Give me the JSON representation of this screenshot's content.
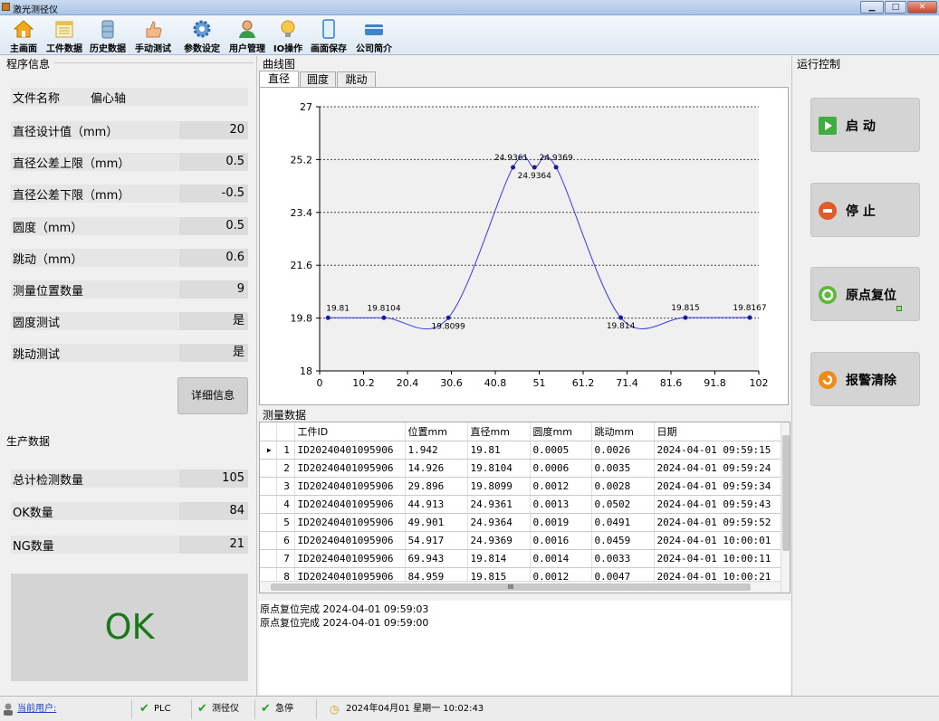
{
  "window": {
    "title": "激光测径仪"
  },
  "toolbar": {
    "items": [
      {
        "label": "主画面",
        "icon": "home-icon"
      },
      {
        "label": "工件数据",
        "icon": "calendar-icon"
      },
      {
        "label": "历史数据",
        "icon": "database-icon"
      },
      {
        "label": "手动测试",
        "icon": "hand-icon"
      },
      {
        "label": "参数设定",
        "icon": "gear-icon"
      },
      {
        "label": "用户管理",
        "icon": "users-icon"
      },
      {
        "label": "IO操作",
        "icon": "bulb-icon"
      },
      {
        "label": "画面保存",
        "icon": "tablet-icon"
      },
      {
        "label": "公司简介",
        "icon": "card-icon"
      }
    ]
  },
  "program": {
    "group_label": "程序信息",
    "file_label": "文件名称",
    "file_value": "偏心轴",
    "rows": [
      {
        "label": "直径设计值（mm）",
        "value": "20"
      },
      {
        "label": "直径公差上限（mm）",
        "value": "0.5"
      },
      {
        "label": "直径公差下限（mm）",
        "value": "-0.5"
      },
      {
        "label": "圆度（mm）",
        "value": "0.5"
      },
      {
        "label": "跳动（mm）",
        "value": "0.6"
      },
      {
        "label": "测量位置数量",
        "value": "9"
      },
      {
        "label": "圆度测试",
        "value": "是"
      },
      {
        "label": "跳动测试",
        "value": "是"
      }
    ],
    "detail_button": "详细信息"
  },
  "production": {
    "group_label": "生产数据",
    "rows": [
      {
        "label": "总计检测数量",
        "value": "105"
      },
      {
        "label": "OK数量",
        "value": "84"
      },
      {
        "label": "NG数量",
        "value": "21"
      }
    ],
    "result": "OK",
    "result_color": "#1a7a1a"
  },
  "curve": {
    "group_label": "曲线图",
    "tabs": [
      "直径",
      "圆度",
      "跳动"
    ]
  },
  "chart_data": {
    "type": "line",
    "x": [
      1.942,
      14.926,
      29.896,
      44.913,
      49.901,
      54.917,
      69.943,
      84.959,
      99.9
    ],
    "values": [
      19.81,
      19.8104,
      19.8099,
      24.9361,
      24.9364,
      24.9369,
      19.814,
      19.815,
      19.8167
    ],
    "labels": [
      "19.81",
      "19.8104",
      "19.8099",
      "24.9361",
      "24.9364",
      "24.9369",
      "19.814",
      "19.815",
      "19.8167"
    ],
    "xticks": [
      "0",
      "10.2",
      "20.4",
      "30.6",
      "40.8",
      "51",
      "61.2",
      "71.4",
      "81.6",
      "91.8",
      "102"
    ],
    "yticks": [
      "18",
      "19.8",
      "21.6",
      "23.4",
      "25.2",
      "27"
    ],
    "xlim": [
      0,
      102
    ],
    "ylim": [
      18,
      27
    ],
    "line_color": "#3a3ae0",
    "grid": "horizontal dashed"
  },
  "measure": {
    "group_label": "测量数据",
    "columns": [
      "工件ID",
      "位置mm",
      "直径mm",
      "圆度mm",
      "跳动mm",
      "日期"
    ],
    "rows": [
      [
        "1",
        "ID20240401095906",
        "1.942",
        "19.81",
        "0.0005",
        "0.0026",
        "2024-04-01 09:59:15"
      ],
      [
        "2",
        "ID20240401095906",
        "14.926",
        "19.8104",
        "0.0006",
        "0.0035",
        "2024-04-01 09:59:24"
      ],
      [
        "3",
        "ID20240401095906",
        "29.896",
        "19.8099",
        "0.0012",
        "0.0028",
        "2024-04-01 09:59:34"
      ],
      [
        "4",
        "ID20240401095906",
        "44.913",
        "24.9361",
        "0.0013",
        "0.0502",
        "2024-04-01 09:59:43"
      ],
      [
        "5",
        "ID20240401095906",
        "49.901",
        "24.9364",
        "0.0019",
        "0.0491",
        "2024-04-01 09:59:52"
      ],
      [
        "6",
        "ID20240401095906",
        "54.917",
        "24.9369",
        "0.0016",
        "0.0459",
        "2024-04-01 10:00:01"
      ],
      [
        "7",
        "ID20240401095906",
        "69.943",
        "19.814",
        "0.0014",
        "0.0033",
        "2024-04-01 10:00:11"
      ],
      [
        "8",
        "ID20240401095906",
        "84.959",
        "19.815",
        "0.0012",
        "0.0047",
        "2024-04-01 10:00:21"
      ]
    ],
    "scroll_mark": "III"
  },
  "log": {
    "lines": [
      "原点复位完成  2024-04-01 09:59:03",
      "原点复位完成  2024-04-01 09:59:00"
    ]
  },
  "control": {
    "group_label": "运行控制",
    "start": "启 动",
    "stop": "停 止",
    "home": "原点复位",
    "alarm": "报警清除"
  },
  "status": {
    "user_label": "当前用户:",
    "plc": "PLC",
    "gauge": "测径仪",
    "estop": "急停",
    "datetime": "2024年04月01  星期一  10:02:43"
  }
}
